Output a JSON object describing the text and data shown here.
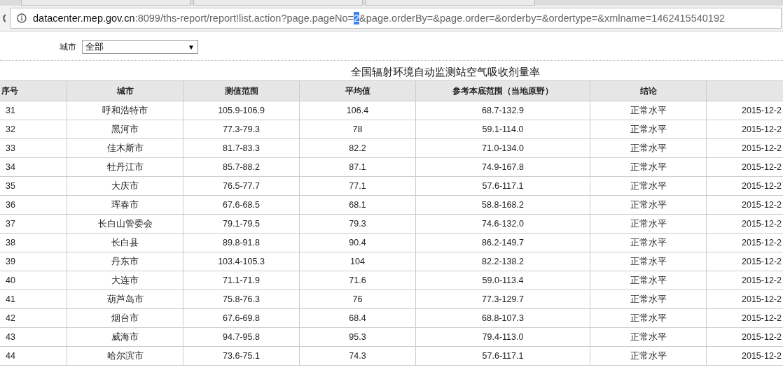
{
  "address_bar": {
    "url_parts": [
      {
        "text": "datacenter.mep.gov.cn",
        "kind": "host"
      },
      {
        "text": ":8099/ths-report/report!list.action?page.pageNo=",
        "kind": "path"
      },
      {
        "text": "2",
        "kind": "selected"
      },
      {
        "text": "&page.orderBy=&page.order=&orderby=&ordertype=&xmlname=1462415540192",
        "kind": "path"
      }
    ]
  },
  "filter": {
    "label": "城市",
    "value": "全部",
    "arrow": "▼"
  },
  "table": {
    "title": "全国辐射环境自动监测站空气吸收剂量率",
    "columns": [
      "序号",
      "城市",
      "测值范围",
      "平均值",
      "参考本底范围（当地原野）",
      "结论"
    ],
    "rows": [
      [
        "31",
        "呼和浩特市",
        "105.9-106.9",
        "106.4",
        "68.7-132.9",
        "正常水平",
        "2015-12-2"
      ],
      [
        "32",
        "黑河市",
        "77.3-79.3",
        "78",
        "59.1-114.0",
        "正常水平",
        "2015-12-2"
      ],
      [
        "33",
        "佳木斯市",
        "81.7-83.3",
        "82.2",
        "71.0-134.0",
        "正常水平",
        "2015-12-2"
      ],
      [
        "34",
        "牡丹江市",
        "85.7-88.2",
        "87.1",
        "74.9-167.8",
        "正常水平",
        "2015-12-2"
      ],
      [
        "35",
        "大庆市",
        "76.5-77.7",
        "77.1",
        "57.6-117.1",
        "正常水平",
        "2015-12-2"
      ],
      [
        "36",
        "珲春市",
        "67.6-68.5",
        "68.1",
        "58.8-168.2",
        "正常水平",
        "2015-12-2"
      ],
      [
        "37",
        "长白山管委会",
        "79.1-79.5",
        "79.3",
        "74.6-132.0",
        "正常水平",
        "2015-12-2"
      ],
      [
        "38",
        "长白县",
        "89.8-91.8",
        "90.4",
        "86.2-149.7",
        "正常水平",
        "2015-12-2"
      ],
      [
        "39",
        "丹东市",
        "103.4-105.3",
        "104",
        "82.2-138.2",
        "正常水平",
        "2015-12-2"
      ],
      [
        "40",
        "大连市",
        "71.1-71.9",
        "71.6",
        "59.0-113.4",
        "正常水平",
        "2015-12-2"
      ],
      [
        "41",
        "葫芦岛市",
        "75.8-76.3",
        "76",
        "77.3-129.7",
        "正常水平",
        "2015-12-2"
      ],
      [
        "42",
        "烟台市",
        "67.6-69.8",
        "68.4",
        "68.8-107.3",
        "正常水平",
        "2015-12-2"
      ],
      [
        "43",
        "威海市",
        "94.7-95.8",
        "95.3",
        "79.4-113.0",
        "正常水平",
        "2015-12-2"
      ],
      [
        "44",
        "哈尔滨市",
        "73.6-75.1",
        "74.3",
        "57.6-117.1",
        "正常水平",
        "2015-12-2"
      ]
    ]
  }
}
